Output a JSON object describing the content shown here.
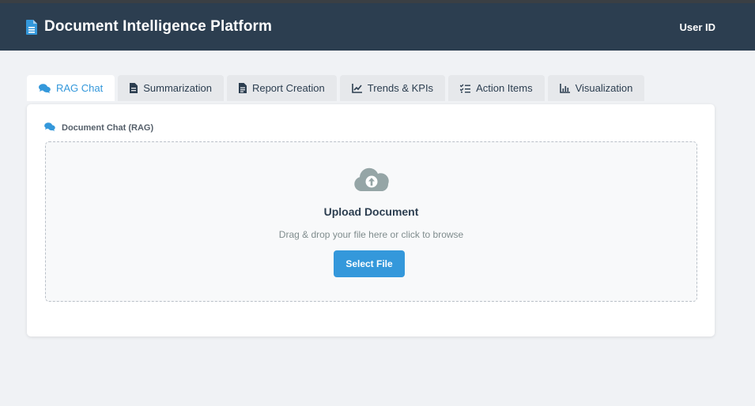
{
  "header": {
    "title": "Document Intelligence Platform",
    "user": "User ID",
    "icon": "file-document-icon"
  },
  "tabs": [
    {
      "label": "RAG Chat",
      "icon": "chat-bubbles-icon",
      "active": true
    },
    {
      "label": "Summarization",
      "icon": "file-icon",
      "active": false
    },
    {
      "label": "Report Creation",
      "icon": "report-file-icon",
      "active": false
    },
    {
      "label": "Trends & KPIs",
      "icon": "line-chart-icon",
      "active": false
    },
    {
      "label": "Action Items",
      "icon": "checklist-icon",
      "active": false
    },
    {
      "label": "Visualization",
      "icon": "bar-chart-icon",
      "active": false
    }
  ],
  "panel": {
    "heading": "Document Chat (RAG)",
    "upload": {
      "title": "Upload Document",
      "hint": "Drag & drop your file here or click to browse",
      "button": "Select File",
      "icon": "cloud-upload-icon"
    }
  },
  "colors": {
    "header_bg": "#2c3e50",
    "accent": "#3498db",
    "page_bg": "#f0f2f5"
  }
}
